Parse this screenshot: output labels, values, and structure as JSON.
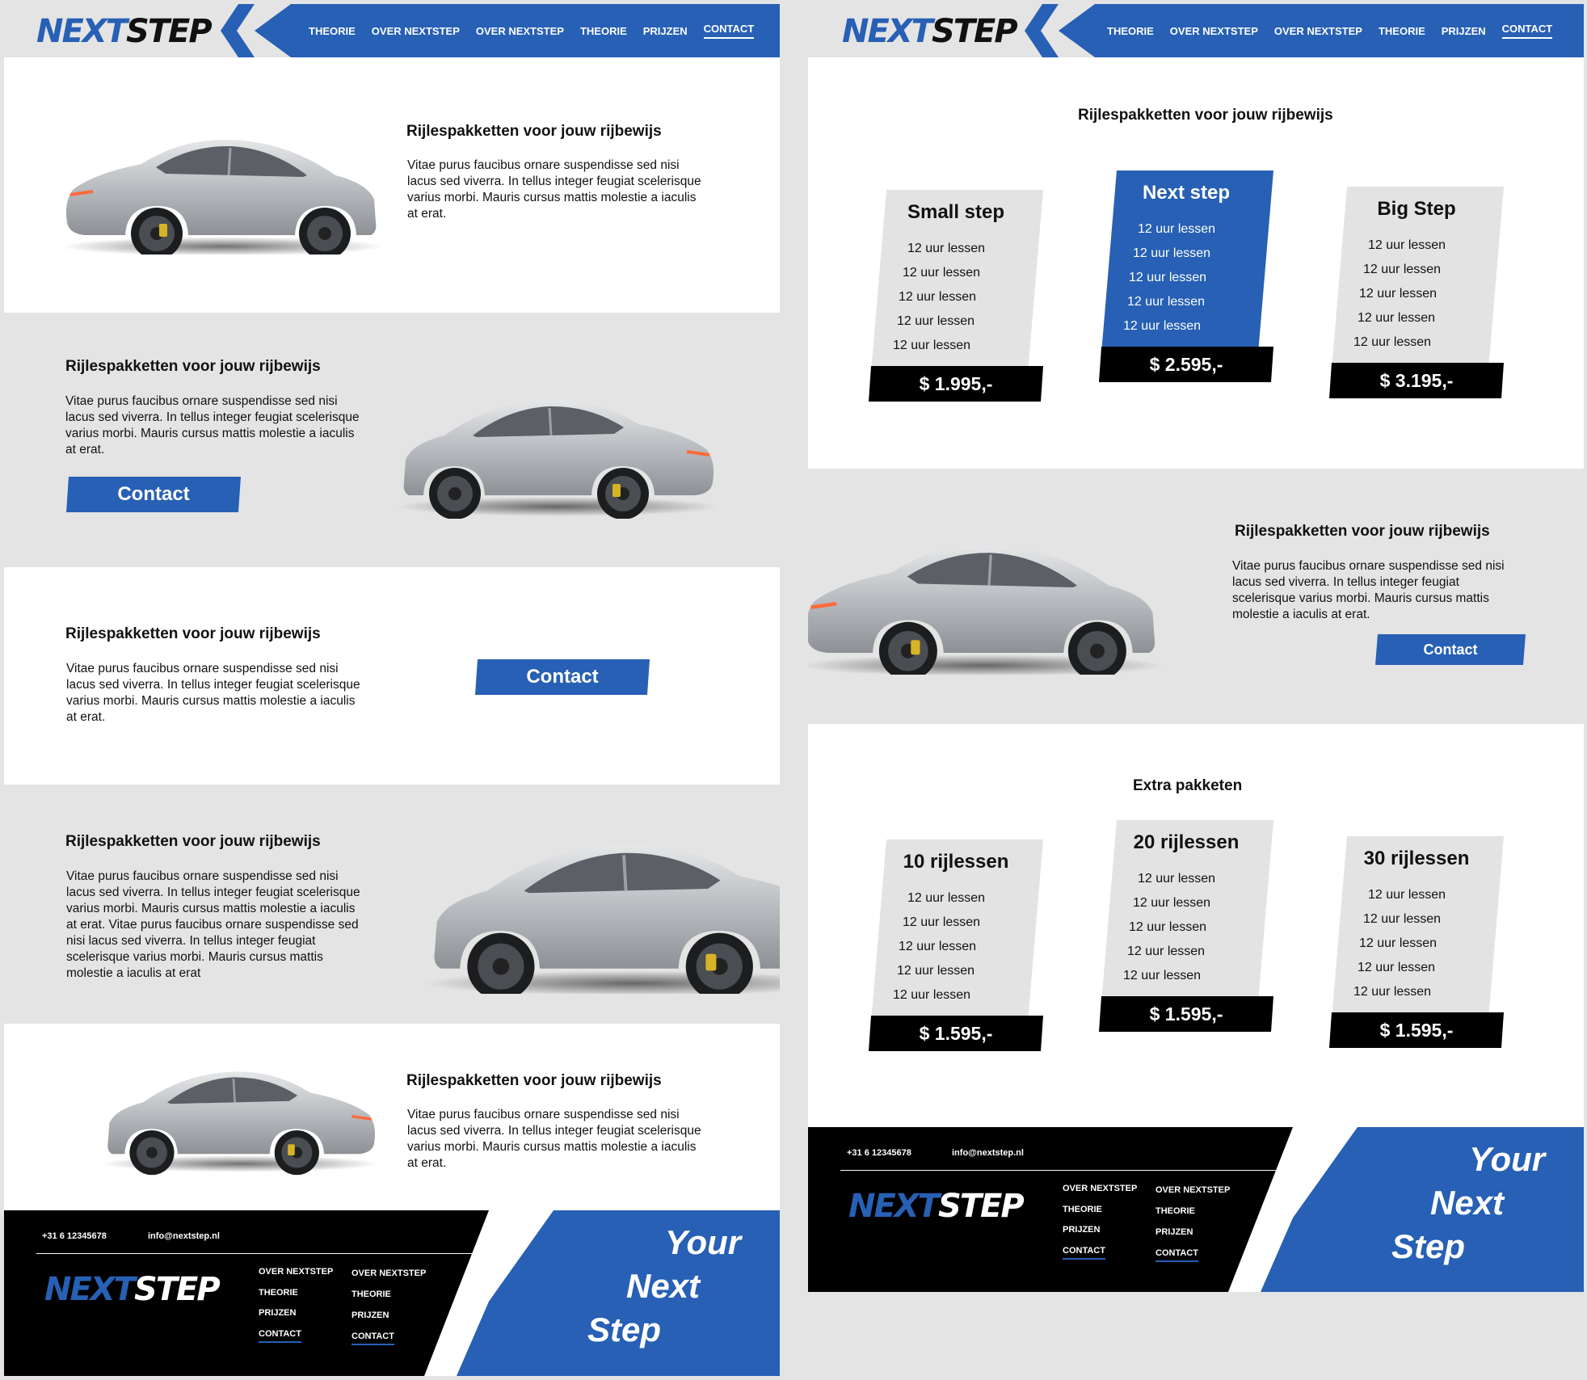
{
  "brand": {
    "logo_next": "NEXT",
    "logo_step": "STEP"
  },
  "nav": {
    "items": [
      "THEORIE",
      "OVER NEXTSTEP",
      "OVER NEXTSTEP",
      "THEORIE",
      "PRIJZEN",
      "CONTACT"
    ],
    "active": "CONTACT"
  },
  "section": {
    "heading": "Rijlespakketten voor jouw rijbewijs",
    "body": "Vitae purus faucibus ornare suspendisse sed nisi lacus sed viverra. In tellus integer feugiat scelerisque varius morbi. Mauris cursus mattis molestie a iaculis at erat.",
    "body_long": "Vitae purus faucibus ornare suspendisse sed nisi lacus sed viverra. In tellus integer feugiat scelerisque varius morbi. Mauris cursus mattis molestie a iaculis at erat. Vitae purus faucibus ornare suspendisse sed nisi lacus sed viverra. In tellus integer feugiat scelerisque varius morbi. Mauris cursus mattis molestie a iaculis at erat",
    "contact_label": "Contact"
  },
  "pricing": {
    "heading": "Rijlespakketten voor jouw rijbewijs",
    "plans": [
      {
        "title": "Small step",
        "items": [
          "12 uur lessen",
          "12 uur lessen",
          "12 uur lessen",
          "12 uur lessen",
          "12 uur lessen"
        ],
        "price": "$ 1.995,-"
      },
      {
        "title": "Next step",
        "items": [
          "12 uur lessen",
          "12 uur lessen",
          "12 uur lessen",
          "12 uur lessen",
          "12 uur lessen"
        ],
        "price": "$ 2.595,-"
      },
      {
        "title": "Big Step",
        "items": [
          "12 uur lessen",
          "12 uur lessen",
          "12 uur lessen",
          "12 uur lessen",
          "12 uur lessen"
        ],
        "price": "$ 3.195,-"
      }
    ]
  },
  "extra": {
    "heading": "Extra pakketen",
    "plans": [
      {
        "title": "10 rijlessen",
        "items": [
          "12 uur lessen",
          "12 uur lessen",
          "12 uur lessen",
          "12 uur lessen",
          "12 uur lessen"
        ],
        "price": "$ 1.595,-"
      },
      {
        "title": "20 rijlessen",
        "items": [
          "12 uur lessen",
          "12 uur lessen",
          "12 uur lessen",
          "12 uur lessen",
          "12 uur lessen"
        ],
        "price": "$ 1.595,-"
      },
      {
        "title": "30 rijlessen",
        "items": [
          "12 uur lessen",
          "12 uur lessen",
          "12 uur lessen",
          "12 uur lessen",
          "12 uur lessen"
        ],
        "price": "$ 1.595,-"
      }
    ]
  },
  "footer": {
    "phone": "+31 6 12345678",
    "email": "info@nextstep.nl",
    "col1": [
      "OVER NEXTSTEP",
      "THEORIE",
      "PRIJZEN",
      "CONTACT"
    ],
    "col2": [
      "OVER NEXTSTEP",
      "THEORIE",
      "PRIJZEN",
      "CONTACT"
    ],
    "tagline": [
      "Your",
      "Next",
      "Step"
    ]
  },
  "colors": {
    "accent": "#2760b4",
    "section_gray": "#e4e4e4",
    "footer": "#000000"
  }
}
